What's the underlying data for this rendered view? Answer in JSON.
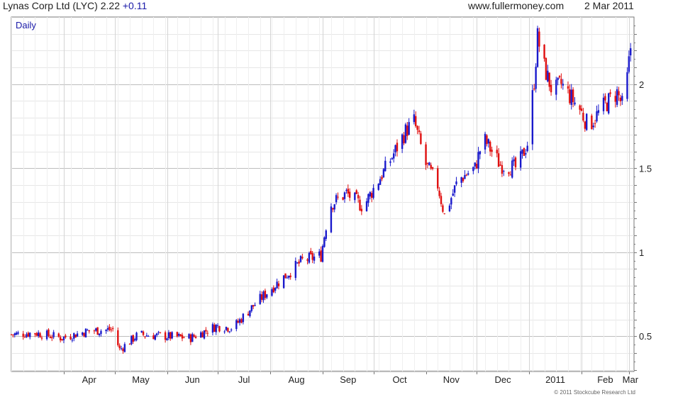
{
  "header": {
    "title": "Lynas Corp Ltd (LYC)",
    "price": "2.22",
    "change": "+0.11",
    "site": "www.fullermoney.com",
    "date": "2 Mar 2011"
  },
  "footer": {
    "copyright": "© 2011 Stockcube Research Ltd"
  },
  "colors": {
    "up": "#1a1acc",
    "down": "#e01010",
    "grid": "#d8d8d8",
    "frame": "#777777",
    "label": "#1a1aa8"
  },
  "chart_data": {
    "type": "candlestick",
    "title": "Lynas Corp Ltd (LYC)",
    "period_label": "Daily",
    "x_tick_labels": [
      "Apr",
      "May",
      "Jun",
      "Jul",
      "Aug",
      "Sep",
      "Oct",
      "Nov",
      "Dec",
      "2011",
      "Feb",
      "Mar"
    ],
    "y_tick_labels": [
      "0.5",
      "1",
      "1.5",
      "2"
    ],
    "ylim": [
      0.29,
      2.4
    ],
    "x_range": [
      "2010-03-01",
      "2011-03-04"
    ],
    "grid": true,
    "points": [
      [
        "2010-03-01",
        0.51
      ],
      [
        "2010-03-15",
        0.52
      ],
      [
        "2010-03-31",
        0.49
      ],
      [
        "2010-04-15",
        0.53
      ],
      [
        "2010-04-30",
        0.54
      ],
      [
        "2010-05-04",
        0.42
      ],
      [
        "2010-05-15",
        0.51
      ],
      [
        "2010-05-31",
        0.5
      ],
      [
        "2010-06-15",
        0.49
      ],
      [
        "2010-06-30",
        0.56
      ],
      [
        "2010-07-10",
        0.55
      ],
      [
        "2010-07-20",
        0.66
      ],
      [
        "2010-07-31",
        0.77
      ],
      [
        "2010-08-10",
        0.86
      ],
      [
        "2010-08-20",
        0.95
      ],
      [
        "2010-08-31",
        0.98
      ],
      [
        "2010-09-05",
        1.28
      ],
      [
        "2010-09-15",
        1.35
      ],
      [
        "2010-09-25",
        1.27
      ],
      [
        "2010-09-30",
        1.36
      ],
      [
        "2010-10-10",
        1.53
      ],
      [
        "2010-10-20",
        1.72
      ],
      [
        "2010-10-25",
        1.78
      ],
      [
        "2010-11-01",
        1.52
      ],
      [
        "2010-11-08",
        1.4
      ],
      [
        "2010-11-12",
        1.22
      ],
      [
        "2010-11-20",
        1.43
      ],
      [
        "2010-11-30",
        1.5
      ],
      [
        "2010-12-05",
        1.68
      ],
      [
        "2010-12-15",
        1.52
      ],
      [
        "2010-12-25",
        1.5
      ],
      [
        "2010-12-31",
        1.65
      ],
      [
        "2011-01-04",
        2.02
      ],
      [
        "2011-01-06",
        2.28
      ],
      [
        "2011-01-10",
        2.1
      ],
      [
        "2011-01-15",
        1.95
      ],
      [
        "2011-01-20",
        2.0
      ],
      [
        "2011-01-31",
        1.85
      ],
      [
        "2011-02-05",
        1.75
      ],
      [
        "2011-02-15",
        1.88
      ],
      [
        "2011-02-22",
        1.95
      ],
      [
        "2011-02-26",
        1.85
      ],
      [
        "2011-03-02",
        2.22
      ]
    ]
  }
}
